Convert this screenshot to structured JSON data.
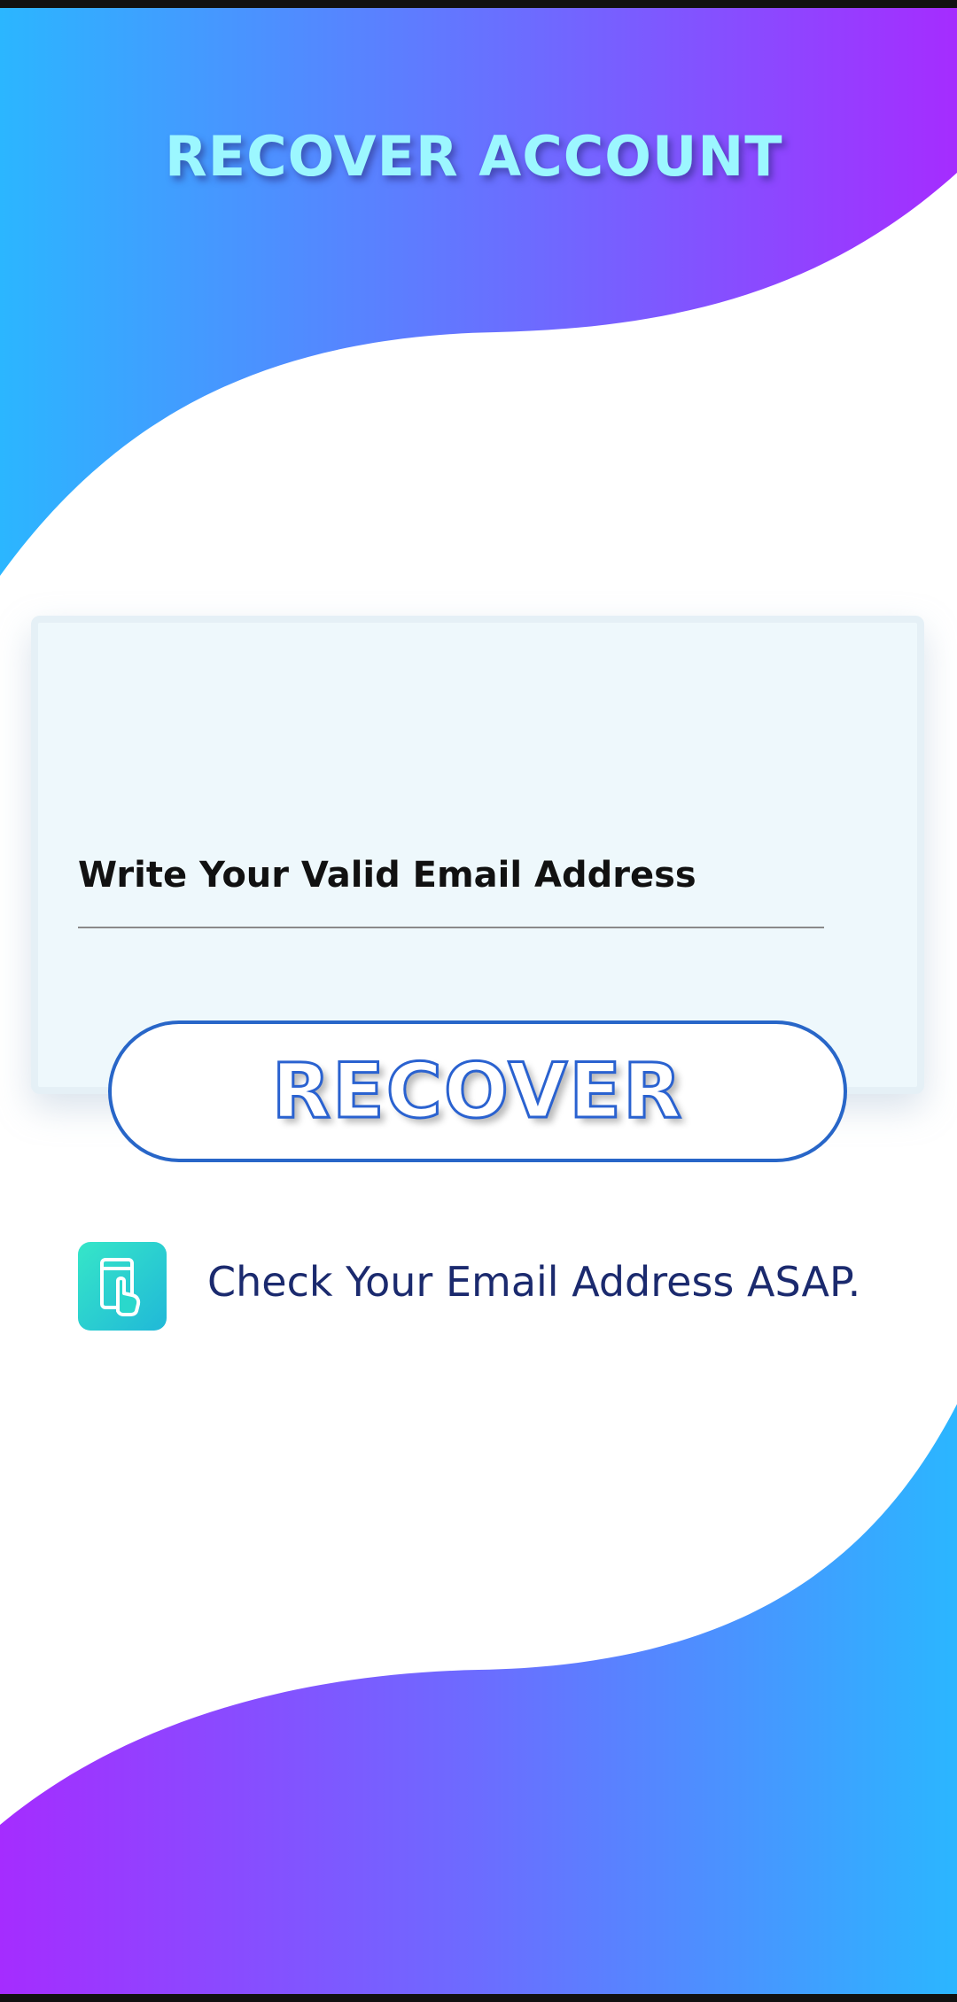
{
  "header": {
    "title": "RECOVER ACCOUNT"
  },
  "form": {
    "email_placeholder": "Write Your Valid Email Address",
    "email_value": "",
    "recover_label": "RECOVER"
  },
  "hint": {
    "icon": "tap-phone-icon",
    "text": "Check Your Email Address ASAP."
  },
  "colors": {
    "gradient_blue": "#2bb6ff",
    "gradient_purple": "#a52cff",
    "title": "#9cf7ff",
    "button_border": "#2866c8",
    "hint_text": "#1b2a6e",
    "icon_bg": "#2ad8cc"
  }
}
